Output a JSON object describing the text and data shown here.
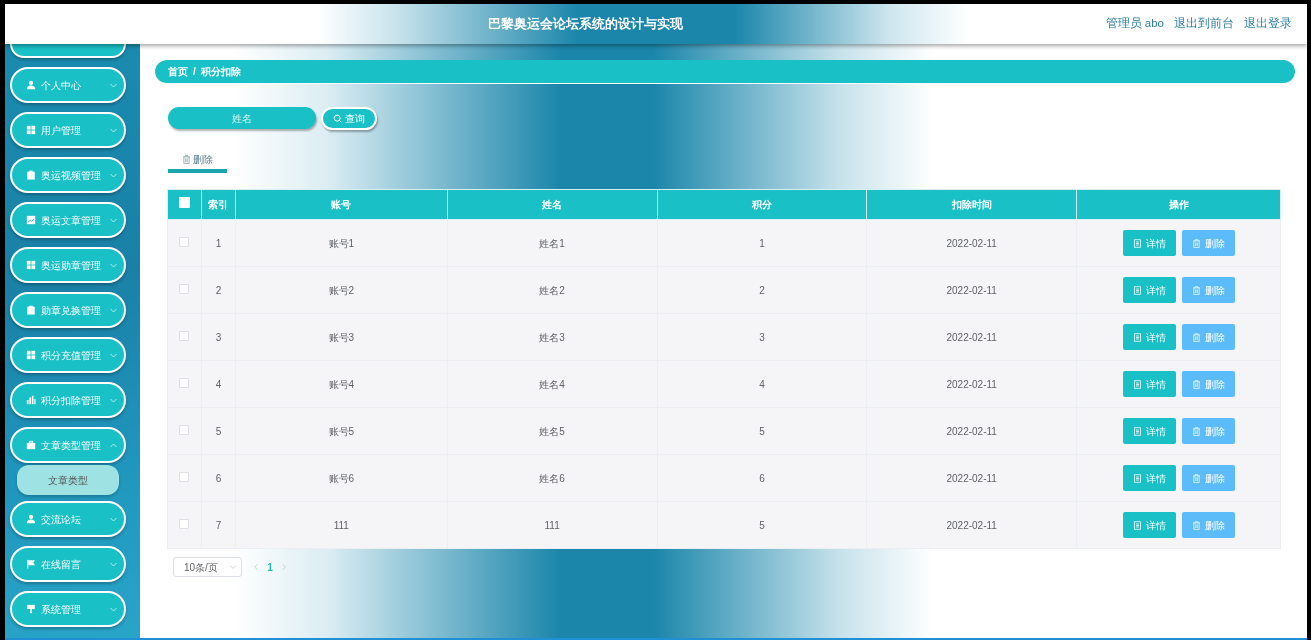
{
  "header": {
    "title": "巴黎奥运会论坛系统的设计与实现",
    "user": "管理员 abo",
    "links": [
      "退出到前台",
      "退出登录"
    ]
  },
  "sidebar": {
    "items": [
      {
        "label": "个人中心",
        "expanded": false
      },
      {
        "label": "用户管理",
        "expanded": false
      },
      {
        "label": "奥运视频管理",
        "expanded": false
      },
      {
        "label": "奥运文章管理",
        "expanded": false
      },
      {
        "label": "奥运勋章管理",
        "expanded": false
      },
      {
        "label": "勋章兑换管理",
        "expanded": false
      },
      {
        "label": "积分充值管理",
        "expanded": false
      },
      {
        "label": "积分扣除管理",
        "expanded": false
      },
      {
        "label": "文章类型管理",
        "expanded": true,
        "children": [
          {
            "label": "文章类型",
            "hovered": true
          }
        ]
      },
      {
        "label": "交流论坛",
        "expanded": false
      },
      {
        "label": "在线留言",
        "expanded": false
      },
      {
        "label": "系统管理",
        "expanded": false
      }
    ]
  },
  "breadcrumb": {
    "items": [
      "首页",
      "积分扣除"
    ],
    "separator": "/"
  },
  "search": {
    "placeholder": "姓名",
    "button": "查询"
  },
  "tabs": [
    {
      "label": "删除",
      "selected": true
    }
  ],
  "table": {
    "columns": [
      "索引",
      "账号",
      "姓名",
      "积分",
      "扣除时间",
      "操作"
    ],
    "header_checked": false,
    "rows": [
      {
        "checked": false,
        "cells": [
          "1",
          "账号1",
          "姓名1",
          "1",
          "2022-02-11"
        ],
        "actions": [
          "详情",
          "删除"
        ]
      },
      {
        "checked": false,
        "cells": [
          "2",
          "账号2",
          "姓名2",
          "2",
          "2022-02-11"
        ],
        "actions": [
          "详情",
          "删除"
        ]
      },
      {
        "checked": false,
        "cells": [
          "3",
          "账号3",
          "姓名3",
          "3",
          "2022-02-11"
        ],
        "actions": [
          "详情",
          "删除"
        ]
      },
      {
        "checked": false,
        "cells": [
          "4",
          "账号4",
          "姓名4",
          "4",
          "2022-02-11"
        ],
        "actions": [
          "详情",
          "删除"
        ]
      },
      {
        "checked": false,
        "cells": [
          "5",
          "账号5",
          "姓名5",
          "5",
          "2022-02-11"
        ],
        "actions": [
          "详情",
          "删除"
        ]
      },
      {
        "checked": false,
        "cells": [
          "6",
          "账号6",
          "姓名6",
          "6",
          "2022-02-11"
        ],
        "actions": [
          "详情",
          "删除"
        ]
      },
      {
        "checked": false,
        "cells": [
          "7",
          "111",
          "111",
          "5",
          "2022-02-11"
        ],
        "actions": [
          "详情",
          "删除"
        ]
      }
    ]
  },
  "pagination": {
    "page_size": "10条/页",
    "pages": [
      {
        "label": "1",
        "selected": true
      }
    ]
  }
}
